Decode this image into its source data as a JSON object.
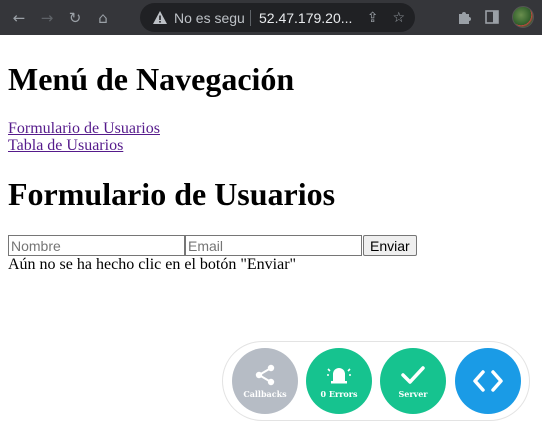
{
  "browser": {
    "not_secure_label": "No es segu",
    "url": "52.47.179.20..."
  },
  "page": {
    "nav_heading": "Menú de Navegación",
    "links": [
      "Formulario de Usuarios",
      "Tabla de Usuarios"
    ],
    "form_heading": "Formulario de Usuarios",
    "name_placeholder": "Nombre",
    "email_placeholder": "Email",
    "submit_label": "Enviar",
    "status_text": "Aún no se ha hecho clic en el botón \"Enviar\""
  },
  "widget": {
    "callbacks_label": "Callbacks",
    "errors_label": "0 Errors",
    "server_label": "Server"
  },
  "colors": {
    "callbacks": "#b6bcc5",
    "ok": "#16c38f",
    "code": "#1a9be6",
    "link_visited": "#551a8b"
  },
  "icons": [
    "back-arrow-icon",
    "forward-arrow-icon",
    "reload-icon",
    "home-icon",
    "warning-icon",
    "share-icon",
    "star-icon",
    "puzzle-icon",
    "side-panel-icon",
    "bell-icon",
    "check-icon",
    "code-icon"
  ]
}
